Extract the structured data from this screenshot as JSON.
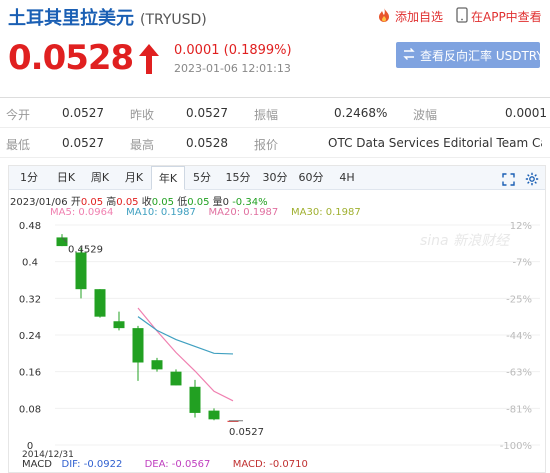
{
  "header": {
    "title": "土耳其里拉美元",
    "code": "(TRYUSD)",
    "add_watch": "添加自选",
    "open_app": "在APP中查看",
    "price": "0.0528",
    "change": "0.0001 (0.1899%)",
    "timestamp": "2023-01-06 12:01:13",
    "reverse_button": "查看反向汇率 USDTRY"
  },
  "quote": {
    "row1": [
      {
        "label": "今开",
        "value": "0.0527"
      },
      {
        "label": "昨收",
        "value": "0.0527"
      },
      {
        "label": "振幅",
        "value": "0.2468%"
      },
      {
        "label": "波幅",
        "value": "0.0001"
      }
    ],
    "row2": [
      {
        "label": "最低",
        "value": "0.0527"
      },
      {
        "label": "最高",
        "value": "0.0528"
      },
      {
        "label": "报价",
        "value": "OTC Data Services Editorial Team Calc..."
      }
    ]
  },
  "tabs": [
    "1分",
    "日K",
    "周K",
    "月K",
    "年K",
    "5分",
    "15分",
    "30分",
    "60分",
    "4H"
  ],
  "active_tab": "年K",
  "ohlc": {
    "date": "2023/01/06",
    "open_label": "开",
    "open": "0.05",
    "high_label": "高",
    "high": "0.05",
    "close_label": "收",
    "close": "0.05",
    "low_label": "低",
    "low": "0.05",
    "vol_label": "量",
    "vol": "0",
    "pct": "-0.34%"
  },
  "ma": {
    "ma5": "MA5: 0.0964",
    "ma10": "MA10: 0.1987",
    "ma20": "MA20: 0.1987",
    "ma30": "MA30: 0.1987"
  },
  "macd": {
    "label": "MACD",
    "dif": "DIF: -0.0922",
    "dea": "DEA: -0.0567",
    "macd": "MACD: -0.0710"
  },
  "watermark": "sina 新浪财经",
  "colors": {
    "up": "#e02020",
    "down": "#22a022",
    "link": "#1a5fb4",
    "ma5": "#f080b0",
    "ma10": "#40a0c0",
    "ma20": "#e070a0",
    "ma30": "#a0b030"
  },
  "chart_data": {
    "type": "candlestick",
    "y_ticks": [
      "0.48",
      "0.4",
      "0.32",
      "0.24",
      "0.16",
      "0.08",
      "0"
    ],
    "pct_ticks": [
      "12%",
      "-7%",
      "-25%",
      "-44%",
      "-63%",
      "-81%",
      "-100%"
    ],
    "ylim": [
      0,
      0.48
    ],
    "x_label_first": "2014/12/31",
    "max_label": "0.4529",
    "last_label": "0.0527",
    "candles": [
      {
        "open": 0.4529,
        "high": 0.46,
        "low": 0.434,
        "close": 0.434
      },
      {
        "open": 0.42,
        "high": 0.43,
        "low": 0.32,
        "close": 0.34
      },
      {
        "open": 0.34,
        "high": 0.34,
        "low": 0.278,
        "close": 0.28
      },
      {
        "open": 0.27,
        "high": 0.291,
        "low": 0.25,
        "close": 0.255
      },
      {
        "open": 0.255,
        "high": 0.26,
        "low": 0.14,
        "close": 0.18
      },
      {
        "open": 0.185,
        "high": 0.19,
        "low": 0.16,
        "close": 0.165
      },
      {
        "open": 0.16,
        "high": 0.165,
        "low": 0.13,
        "close": 0.13
      },
      {
        "open": 0.127,
        "high": 0.142,
        "low": 0.06,
        "close": 0.07
      },
      {
        "open": 0.075,
        "high": 0.08,
        "low": 0.054,
        "close": 0.056
      },
      {
        "open": 0.0527,
        "high": 0.0528,
        "low": 0.0527,
        "close": 0.0528
      }
    ],
    "ma5": [
      null,
      null,
      null,
      null,
      0.2988,
      0.2488,
      0.2018,
      0.1614,
      0.1172,
      0.0964
    ],
    "ma10": [
      null,
      null,
      null,
      null,
      0.28,
      0.25,
      0.23,
      0.215,
      0.2,
      0.1987
    ]
  }
}
